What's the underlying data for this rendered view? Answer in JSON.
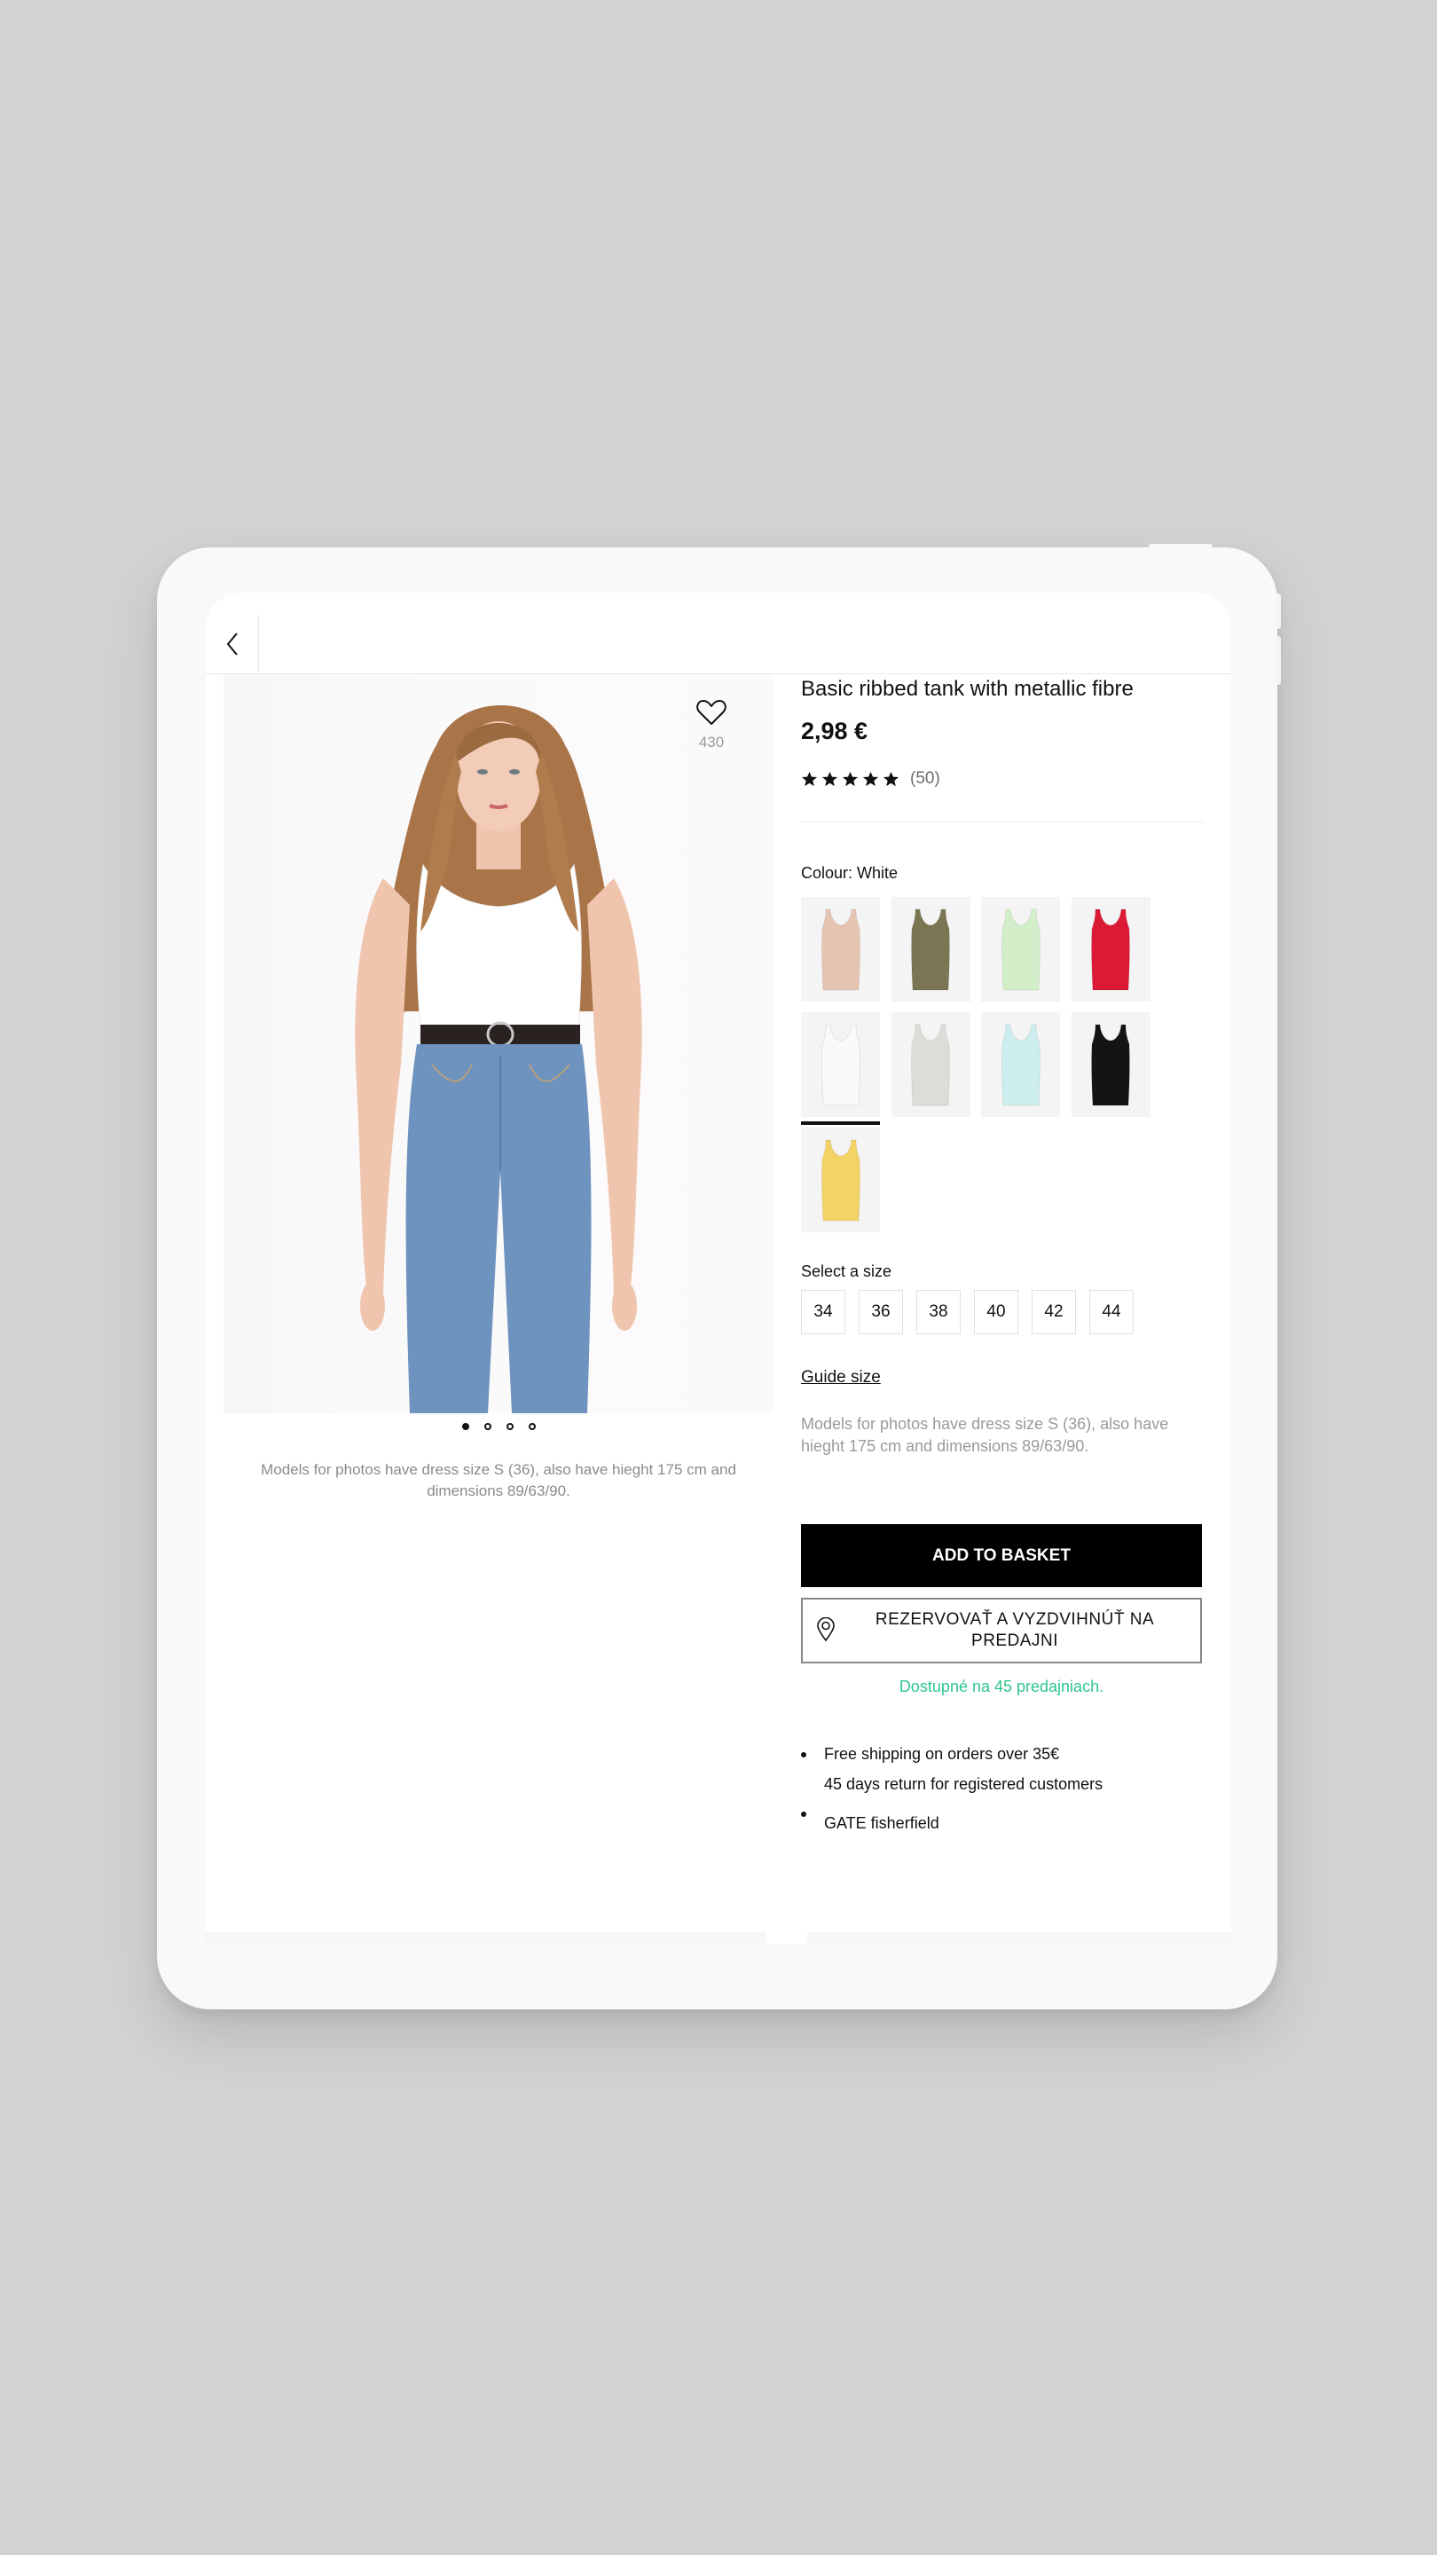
{
  "header": {
    "back_label": "Back"
  },
  "gallery": {
    "favourites_count": "430",
    "slides": 4,
    "active_slide": 1,
    "caption": "Models for photos have dress size S (36), also have hieght 175 cm and dimensions 89/63/90."
  },
  "product": {
    "title": "Basic ribbed tank with metallic fibre",
    "price": "2,98 €",
    "rating": {
      "stars": 5,
      "max": 5,
      "count_label": "(50)"
    }
  },
  "colour": {
    "label": "Colour: White",
    "selected": "White",
    "options": [
      {
        "name": "Beige",
        "hex": "#e6c4b2"
      },
      {
        "name": "Khaki",
        "hex": "#7a7552"
      },
      {
        "name": "Mint",
        "hex": "#d2efc9"
      },
      {
        "name": "Red",
        "hex": "#dc1a35"
      },
      {
        "name": "White",
        "hex": "#fafafa"
      },
      {
        "name": "Light grey",
        "hex": "#dddcd7"
      },
      {
        "name": "Light blue",
        "hex": "#cdeeee"
      },
      {
        "name": "Black",
        "hex": "#141414"
      },
      {
        "name": "Yellow",
        "hex": "#f3d364"
      }
    ]
  },
  "size": {
    "label": "Select a size",
    "options": [
      "34",
      "36",
      "38",
      "40",
      "42",
      "44"
    ],
    "guide_label": "Guide size",
    "model_note": "Models for photos have dress size S (36), also have hieght 175 cm and dimensions 89/63/90."
  },
  "actions": {
    "add_to_basket": "ADD TO BASKET",
    "reserve": "REZERVOVAŤ A VYZDVIHNÚŤ NA PREDAJNI",
    "availability": "Dostupné na 45 predajniach.",
    "availability_color": "#2ec58b"
  },
  "benefits": [
    {
      "lines": [
        "Free shipping on orders over 35€",
        "45 days return for registered customers"
      ]
    },
    {
      "lines": [
        "GATE fisherfield"
      ]
    }
  ]
}
